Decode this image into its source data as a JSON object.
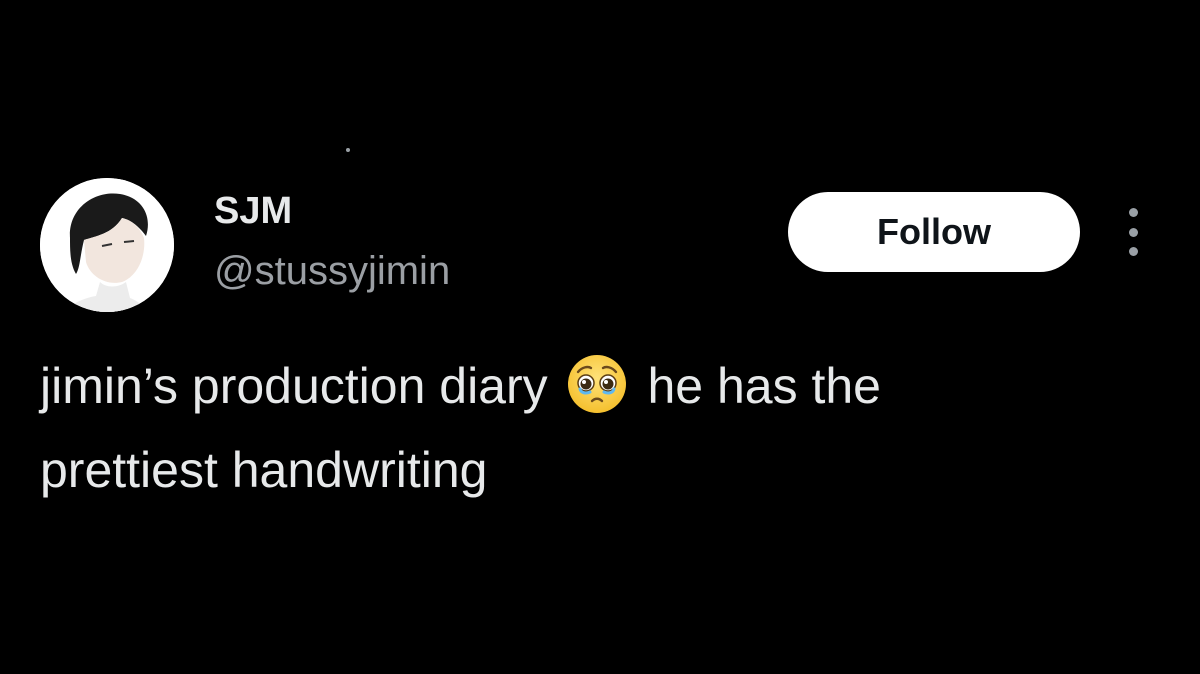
{
  "tweet": {
    "display_name": "SJM",
    "handle": "@stussyjimin",
    "follow_label": "Follow",
    "text_part1": "jimin’s production diary",
    "emoji": "pleading-face-with-tears",
    "text_part2": "he has the",
    "text_part3": "prettiest handwriting"
  },
  "icons": {
    "avatar": "profile-photo",
    "more": "more-vertical-icon"
  },
  "colors": {
    "background": "#000000",
    "primary_text": "#e7e9ea",
    "secondary_text": "#9b9fa4",
    "follow_button_bg": "#ffffff",
    "follow_button_text": "#0f1419"
  }
}
